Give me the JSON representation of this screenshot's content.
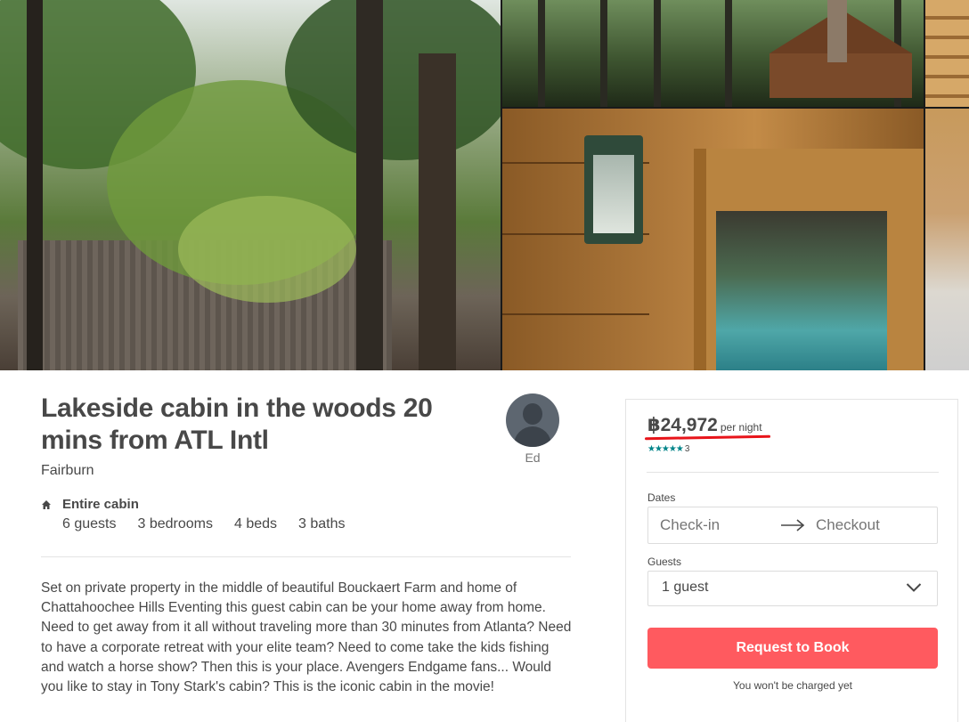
{
  "gallery": {
    "photos": [
      {
        "name": "photo-main",
        "subject": "trees and barn"
      },
      {
        "name": "photo-cabin",
        "subject": "cabin exterior"
      },
      {
        "name": "photo-logs",
        "subject": "log wall"
      },
      {
        "name": "photo-door",
        "subject": "lantern and door"
      },
      {
        "name": "photo-interior",
        "subject": "interior"
      }
    ]
  },
  "listing": {
    "title": "Lakeside cabin in the woods 20 mins from ATL Intl",
    "location": "Fairburn",
    "host_name": "Ed",
    "property_icon": "home-icon",
    "property_type": "Entire cabin",
    "stats": {
      "guests": "6 guests",
      "bedrooms": "3 bedrooms",
      "beds": "4 beds",
      "baths": "3 baths"
    },
    "description": "Set on private property in the middle of beautiful Bouckaert Farm and home of Chattahoochee Hills Eventing this guest cabin can be your home away from home. Need to get away from it all without traveling more than 30 minutes from Atlanta? Need to have a corporate retreat with your elite team? Need to come take the kids fishing and watch a horse show? Then this is your place. Avengers Endgame fans... Would you like to stay in Tony Stark's cabin? This is the iconic cabin in the movie!"
  },
  "booking": {
    "price": "฿24,972",
    "price_unit": "per night",
    "stars": "★★★★★",
    "review_count": "3",
    "dates_label": "Dates",
    "checkin_placeholder": "Check-in",
    "checkout_placeholder": "Checkout",
    "guests_label": "Guests",
    "guests_value": "1 guest",
    "book_button": "Request to Book",
    "no_charge_note": "You won't be charged yet"
  },
  "colors": {
    "accent": "#ff5a5f",
    "stars": "#008489",
    "annotation_underline": "#e8141a",
    "text": "#484848"
  }
}
